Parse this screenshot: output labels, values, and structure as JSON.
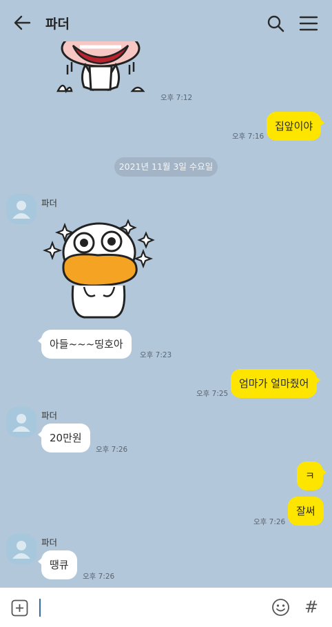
{
  "header": {
    "title": "파더",
    "back_icon": "arrow-left-icon",
    "search_icon": "search-icon",
    "menu_icon": "hamburger-menu-icon"
  },
  "date_divider": "2021년 11월 3일 수요일",
  "messages": [
    {
      "sender": "",
      "time": "오후 7:12",
      "type": "sticker",
      "side": "other"
    },
    {
      "sender": "me",
      "text": "집앞이야",
      "time": "오후 7:16"
    },
    {
      "sender": "파더",
      "time": "",
      "type": "sticker",
      "side": "other"
    },
    {
      "sender": "파더",
      "text": "아들~~~띵호아",
      "time": "오후 7:23"
    },
    {
      "sender": "me",
      "text": "엄마가 얼마줬어",
      "time": "오후 7:25"
    },
    {
      "sender": "파더",
      "text": "20만원",
      "time": "오후 7:26"
    },
    {
      "sender": "me",
      "text": "ㅋ",
      "time": ""
    },
    {
      "sender": "me",
      "text": "잘써",
      "time": "오후 7:26"
    },
    {
      "sender": "파더",
      "text": "땡큐",
      "time": "오후 7:26"
    }
  ],
  "input": {
    "placeholder": "",
    "attach_icon": "plus-square-icon",
    "emoji_icon": "smiley-icon",
    "hash_label": "#"
  },
  "colors": {
    "background": "#b2c7da",
    "my_bubble": "#fee500",
    "other_bubble": "#ffffff",
    "date_pill": "#a2b4c6"
  }
}
